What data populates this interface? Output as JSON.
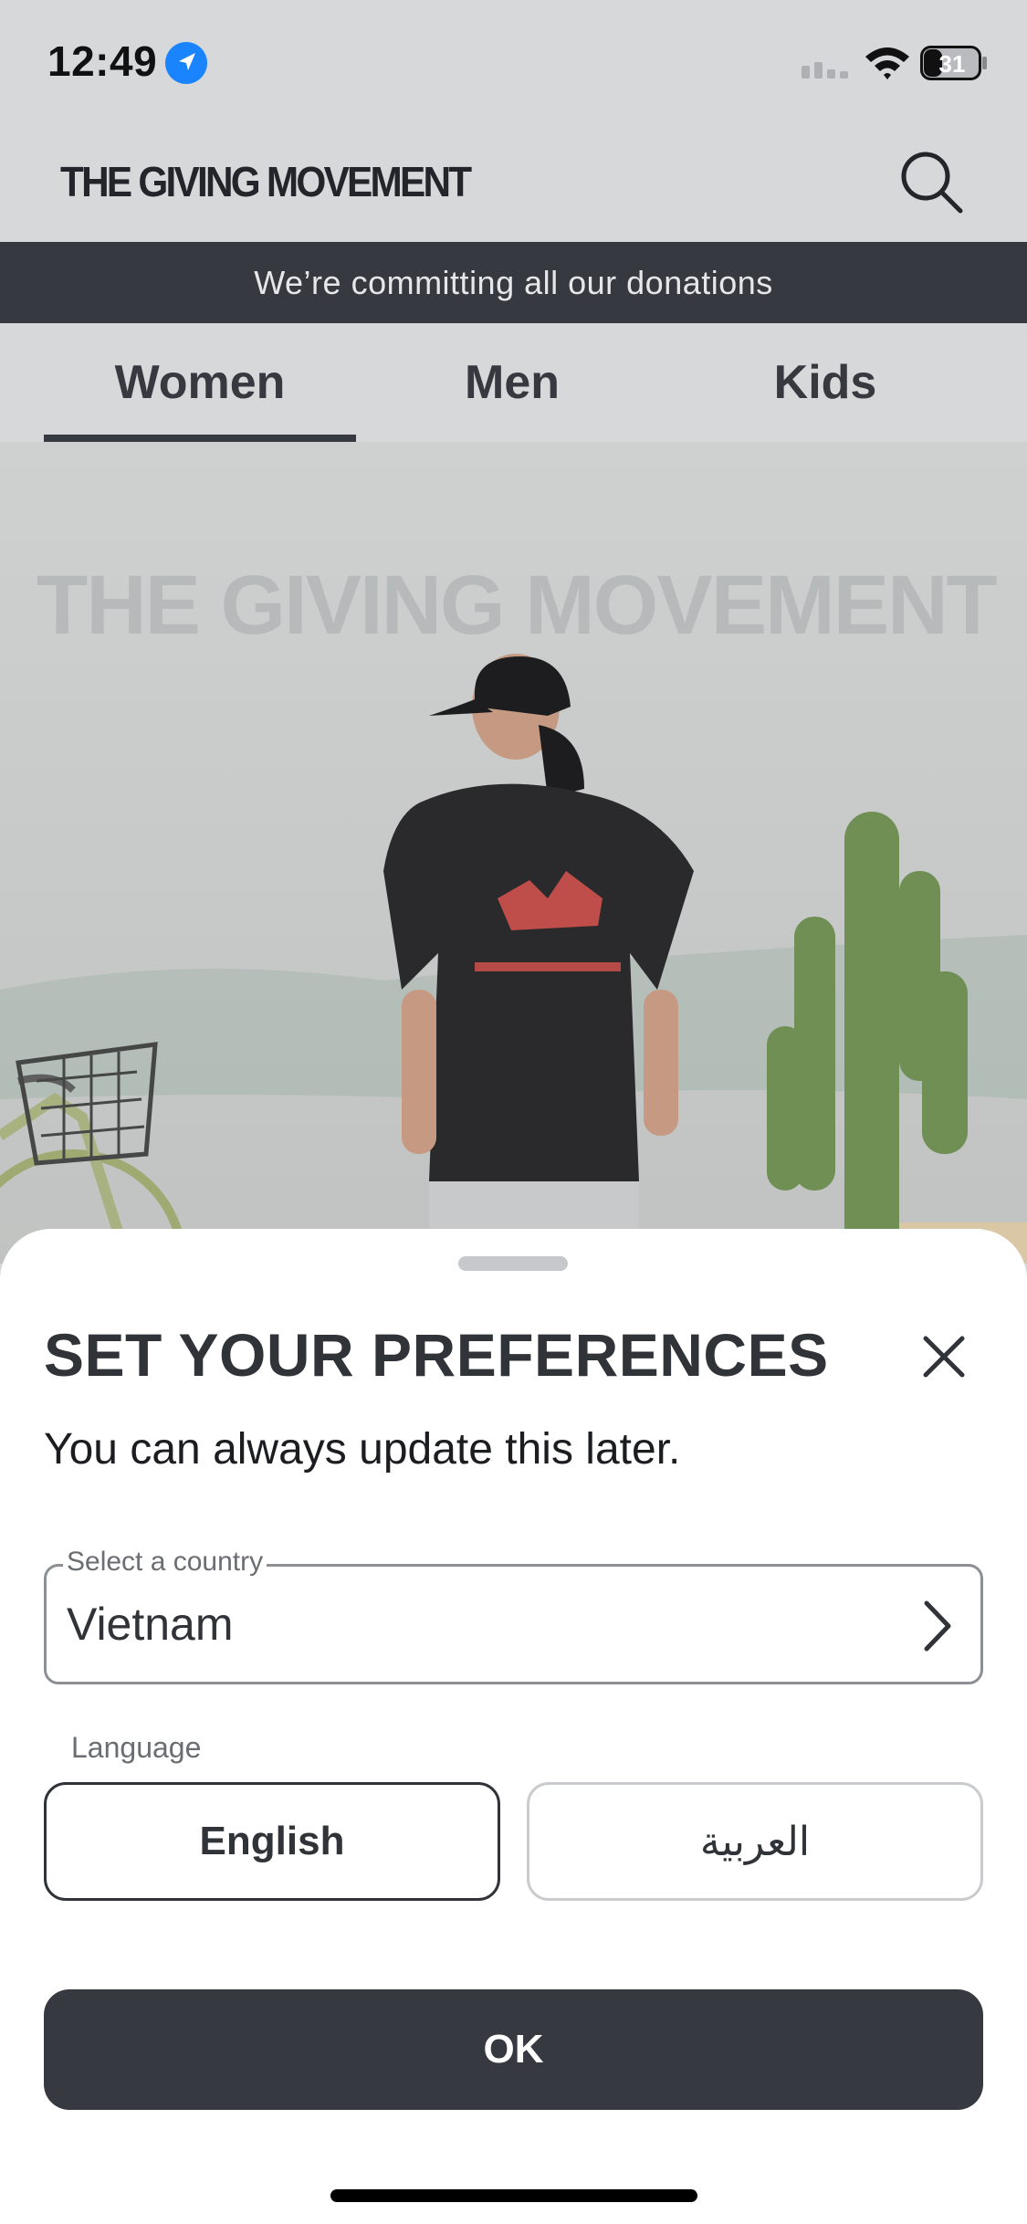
{
  "status_bar": {
    "time": "12:49",
    "battery": "31"
  },
  "header": {
    "brand": "THE GIVING MOVEMENT"
  },
  "banner": {
    "text": "We’re committing all our donations"
  },
  "tabs": [
    {
      "label": "Women",
      "active": true
    },
    {
      "label": "Men",
      "active": false
    },
    {
      "label": "Kids",
      "active": false
    }
  ],
  "hero": {
    "wall_text": "THE GIVING MOVEMENT"
  },
  "sheet": {
    "title": "SET YOUR PREFERENCES",
    "subtitle": "You can always update this later.",
    "country": {
      "label": "Select a country",
      "value": "Vietnam"
    },
    "language": {
      "label": "Language",
      "options": [
        {
          "label": "English",
          "selected": true
        },
        {
          "label": "العربية",
          "selected": false
        }
      ]
    },
    "ok_label": "OK"
  },
  "colors": {
    "accent": "#363a40",
    "header_bg": "#d6d8da",
    "location_blue": "#1a84ff"
  }
}
